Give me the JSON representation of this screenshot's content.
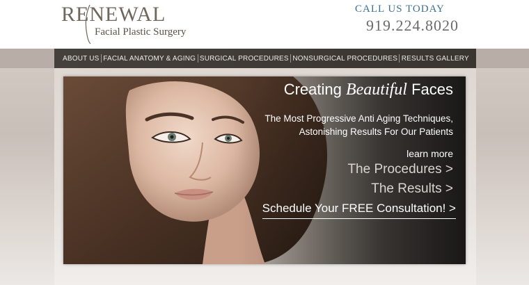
{
  "header": {
    "logo_word": "RENEWAL",
    "logo_subtitle": "Facial Plastic Surgery",
    "call_label": "CALL US TODAY",
    "phone": "919.224.8020"
  },
  "nav": {
    "items": [
      {
        "label": "ABOUT US"
      },
      {
        "label": "FACIAL ANATOMY & AGING"
      },
      {
        "label": "SURGICAL PROCEDURES"
      },
      {
        "label": "NONSURGICAL PROCEDURES"
      },
      {
        "label": "RESULTS GALLERY"
      }
    ]
  },
  "hero": {
    "title_pre": "Creating",
    "title_em": "Beautiful",
    "title_post": "Faces",
    "subtitle_line1": "The Most Progressive Anti Aging Techniques,",
    "subtitle_line2": "Astonishing Results For Our Patients",
    "learn_more": "learn more",
    "procedures_link": "The Procedures >",
    "results_link": "The Results >",
    "consult_link": "Schedule Your FREE Consultation! >"
  },
  "colors": {
    "nav_bg": "#3a3531",
    "call_label": "#3c6f8e",
    "logo": "#6f665c"
  }
}
